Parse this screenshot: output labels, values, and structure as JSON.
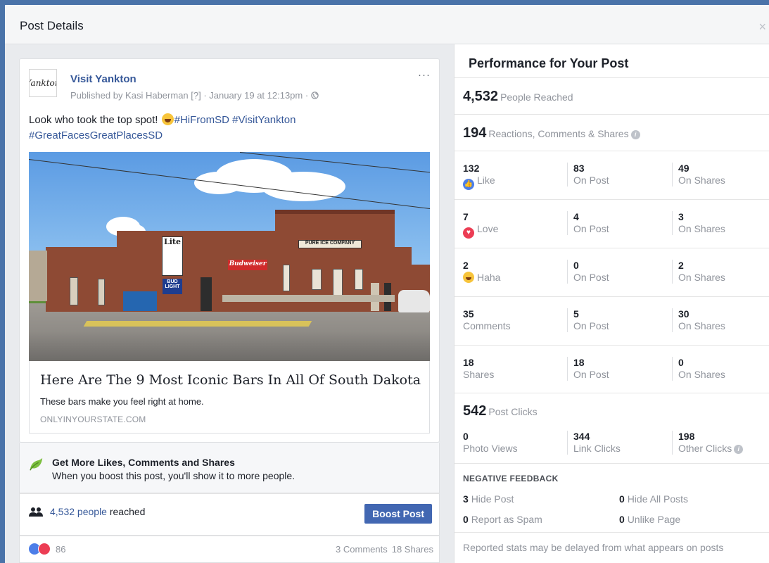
{
  "dialog": {
    "title": "Post Details",
    "close_glyph": "×"
  },
  "post": {
    "avatar_text": "Yankton",
    "page_name": "Visit Yankton",
    "published": "Published by Kasi Haberman [?] · January 19 at 12:13pm · ",
    "more_glyph": "···",
    "text_plain": "Look who took the top spot! ",
    "text_tags_line1": "#HiFromSD #VisitYankton",
    "text_tags_line2": "#GreatFacesGreatPlacesSD",
    "photo_sign_lite": "Lite",
    "photo_sign_bud": "BUD LIGHT",
    "photo_sign_pure": "PURE ICE COMPANY",
    "photo_sign_budweiser": "Budweiser",
    "link_title": "Here Are The 9 Most Iconic Bars In All Of South Dakota",
    "link_desc": "These bars make you feel right at home.",
    "link_domain": "ONLYINYOURSTATE.COM"
  },
  "promo": {
    "title": "Get More Likes, Comments and Shares",
    "desc": "When you boost this post, you'll show it to more people."
  },
  "reach_row": {
    "count": "4,532 people",
    "suffix": " reached",
    "boost_label": "Boost Post"
  },
  "reactions_row": {
    "count": "86",
    "comments": "3 Comments",
    "shares": "18 Shares"
  },
  "performance": {
    "title": "Performance for Your Post",
    "reached_num": "4,532",
    "reached_label": "People Reached",
    "engagement_num": "194",
    "engagement_label": "Reactions, Comments & Shares",
    "rows": [
      {
        "c1v": "132",
        "c1l": "Like",
        "c2v": "83",
        "c2l": "On Post",
        "c3v": "49",
        "c3l": "On Shares"
      },
      {
        "c1v": "7",
        "c1l": "Love",
        "c2v": "4",
        "c2l": "On Post",
        "c3v": "3",
        "c3l": "On Shares"
      },
      {
        "c1v": "2",
        "c1l": "Haha",
        "c2v": "0",
        "c2l": "On Post",
        "c3v": "2",
        "c3l": "On Shares"
      },
      {
        "c1v": "35",
        "c1l": "Comments",
        "c2v": "5",
        "c2l": "On Post",
        "c3v": "30",
        "c3l": "On Shares"
      },
      {
        "c1v": "18",
        "c1l": "Shares",
        "c2v": "18",
        "c2l": "On Post",
        "c3v": "0",
        "c3l": "On Shares"
      }
    ],
    "clicks_num": "542",
    "clicks_label": "Post Clicks",
    "clicks": {
      "c1v": "0",
      "c1l": "Photo Views",
      "c2v": "344",
      "c2l": "Link Clicks",
      "c3v": "198",
      "c3l": "Other Clicks"
    },
    "negative_title": "NEGATIVE FEEDBACK",
    "neg": {
      "hide_post_num": "3",
      "hide_post_label": "Hide Post",
      "hide_all_num": "0",
      "hide_all_label": "Hide All Posts",
      "spam_num": "0",
      "spam_label": "Report as Spam",
      "unlike_num": "0",
      "unlike_label": "Unlike Page"
    },
    "footnote": "Reported stats may be delayed from what appears on posts"
  },
  "colors": {
    "frame": "#4a73a9",
    "link": "#365899",
    "button": "#4267b2",
    "like": "#4c7ee8",
    "love": "#ec3d54"
  }
}
